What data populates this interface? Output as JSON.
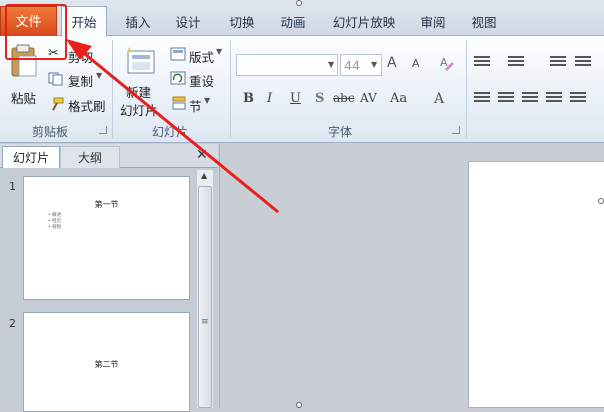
{
  "tabs": {
    "file": "文件",
    "home": "开始",
    "insert": "插入",
    "design": "设计",
    "transitions": "切换",
    "animations": "动画",
    "slideshow": "幻灯片放映",
    "review": "审阅",
    "view": "视图"
  },
  "clipboard": {
    "paste": "粘贴",
    "cut": "剪切",
    "copy": "复制",
    "format_painter": "格式刷",
    "group_label": "剪贴板"
  },
  "slides_group": {
    "new_slide": "新建",
    "new_slide_line2": "幻灯片",
    "layout": "版式",
    "reset": "重设",
    "section": "节",
    "group_label": "幻灯片"
  },
  "font_group": {
    "font_name": "",
    "font_size": "44",
    "grow_label": "A",
    "shrink_label": "A",
    "bold": "B",
    "italic": "I",
    "underline": "U",
    "shadow": "S",
    "strike": "abc",
    "spacing": "AV",
    "case": "Aa",
    "color": "A",
    "group_label": "字体"
  },
  "pane": {
    "tab_slides": "幻灯片",
    "tab_outline": "大纲",
    "close": "✕"
  },
  "slides": [
    {
      "number": "1",
      "title": "第一节",
      "bullets": [
        "概述",
        "经历",
        "规划"
      ]
    },
    {
      "number": "2",
      "title": "第二节"
    }
  ],
  "colors": {
    "file_tab": "#d6441a",
    "highlight": "#e8201b",
    "arrow": "#e8201b"
  }
}
